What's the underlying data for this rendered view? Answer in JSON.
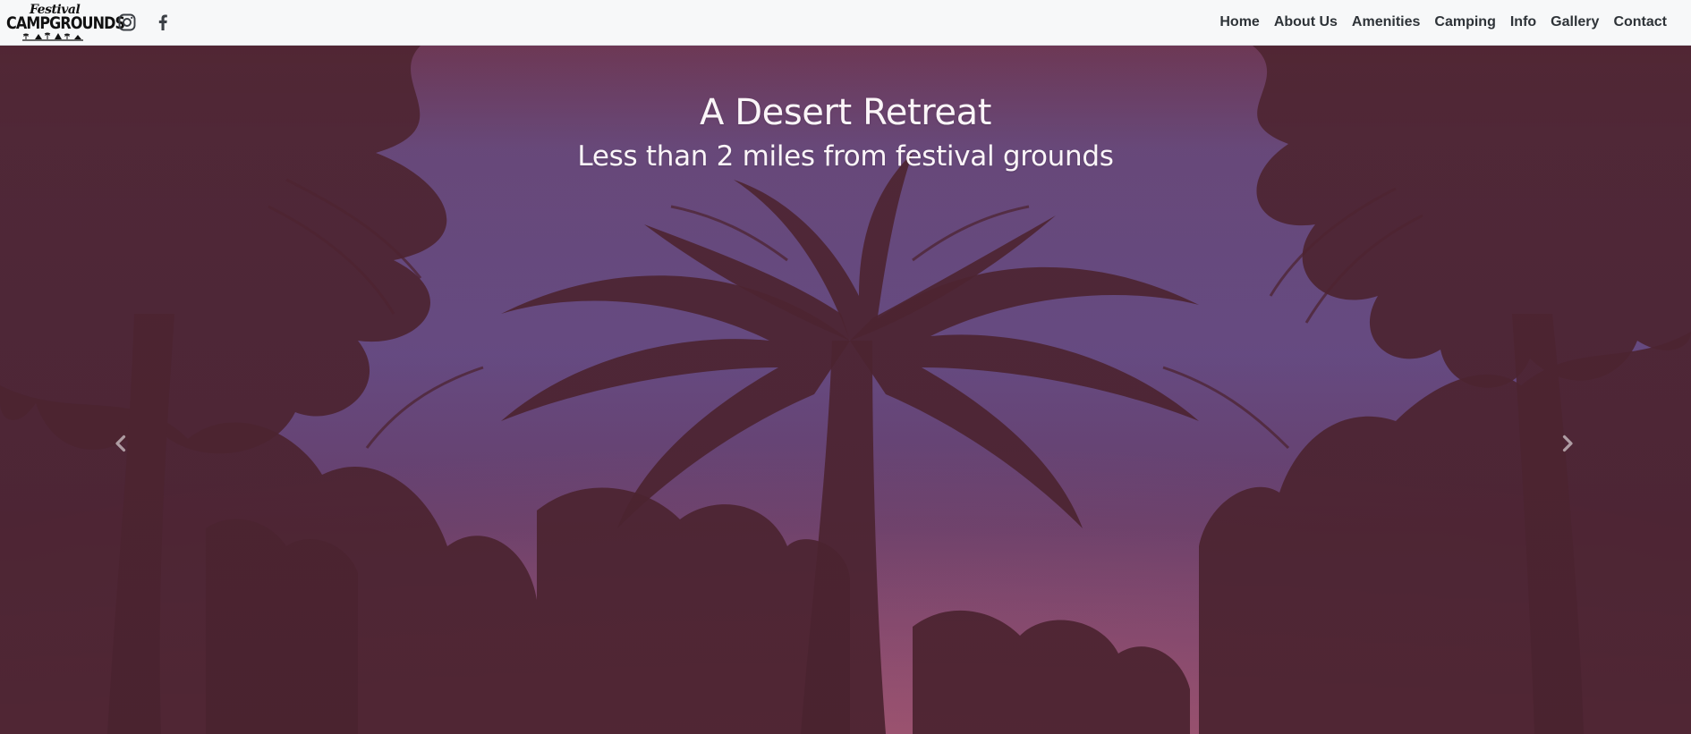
{
  "brand": {
    "script": "Festival",
    "name": "CAMPGROUNDS"
  },
  "social": {
    "instagram_icon": "instagram-icon",
    "facebook_icon": "facebook-icon"
  },
  "nav": {
    "items": [
      {
        "label": "Home"
      },
      {
        "label": "About Us"
      },
      {
        "label": "Amenities"
      },
      {
        "label": "Camping"
      },
      {
        "label": "Info"
      },
      {
        "label": "Gallery"
      },
      {
        "label": "Contact"
      }
    ]
  },
  "hero": {
    "title": "A Desert Retreat",
    "subtitle": "Less than 2 miles from festival grounds",
    "prev_icon": "chevron-left-icon",
    "next_icon": "chevron-right-icon"
  },
  "colors": {
    "navbar_bg": "#f7f8f9",
    "nav_text": "#2e3338",
    "hero_text": "#fbf5f8",
    "sky_purple": "#6e4f82",
    "sky_pink": "#8a4a72",
    "palm_silhouette": "#4a2532"
  }
}
